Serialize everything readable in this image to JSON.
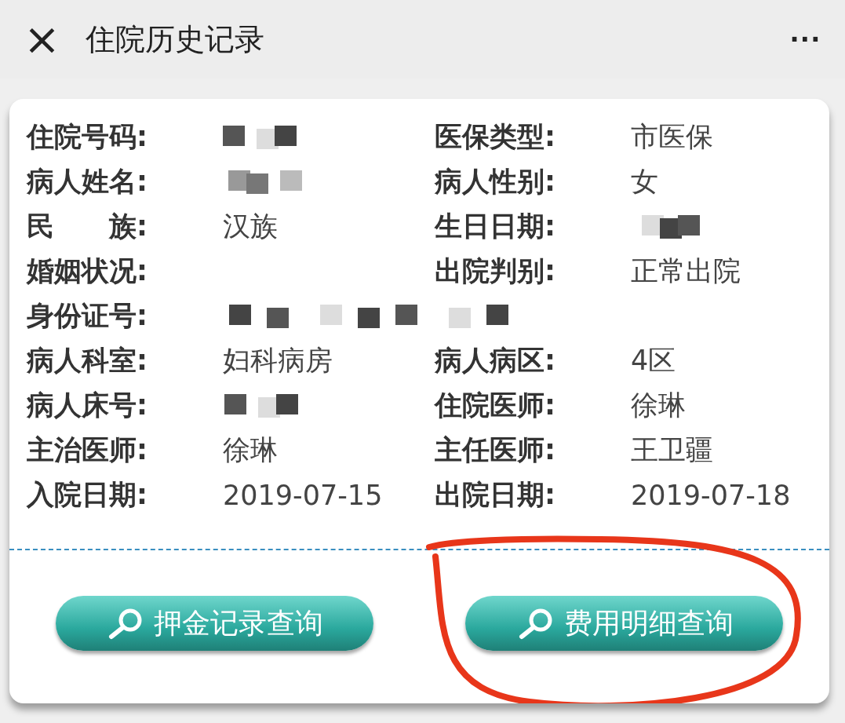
{
  "header": {
    "close": "×",
    "title": "住院历史记录",
    "more": "···"
  },
  "rows": [
    {
      "cells": [
        {
          "label": "住院号码:",
          "redacted": true
        },
        {
          "label": "医保类型:",
          "value": "市医保"
        }
      ]
    },
    {
      "cells": [
        {
          "label": "病人姓名:",
          "redacted": true
        },
        {
          "label": "病人性别:",
          "value": "女"
        }
      ]
    },
    {
      "cells": [
        {
          "label": "民　　族:",
          "value": "汉族"
        },
        {
          "label": "生日日期:",
          "redacted": true
        }
      ]
    },
    {
      "cells": [
        {
          "label": "婚姻状况:"
        },
        {
          "label": "出院判别:",
          "value": "正常出院"
        }
      ]
    },
    {
      "cells": [
        {
          "label": "身份证号:",
          "redacted": true
        }
      ]
    },
    {
      "cells": [
        {
          "label": "病人科室:",
          "value": "妇科病房"
        },
        {
          "label": "病人病区:",
          "value": "4区"
        }
      ]
    },
    {
      "cells": [
        {
          "label": "病人床号:",
          "redacted": true
        },
        {
          "label": "住院医师:",
          "value": "徐琳"
        }
      ]
    },
    {
      "cells": [
        {
          "label": "主治医师:",
          "value": "徐琳"
        },
        {
          "label": "主任医师:",
          "value": "王卫疆"
        }
      ]
    },
    {
      "cells": [
        {
          "label": "入院日期:",
          "value": "2019-07-15"
        },
        {
          "label": "出院日期:",
          "value": "2019-07-18"
        }
      ]
    }
  ],
  "buttons": [
    {
      "label": "押金记录查询"
    },
    {
      "label": "费用明细查询",
      "highlighted": true
    }
  ]
}
